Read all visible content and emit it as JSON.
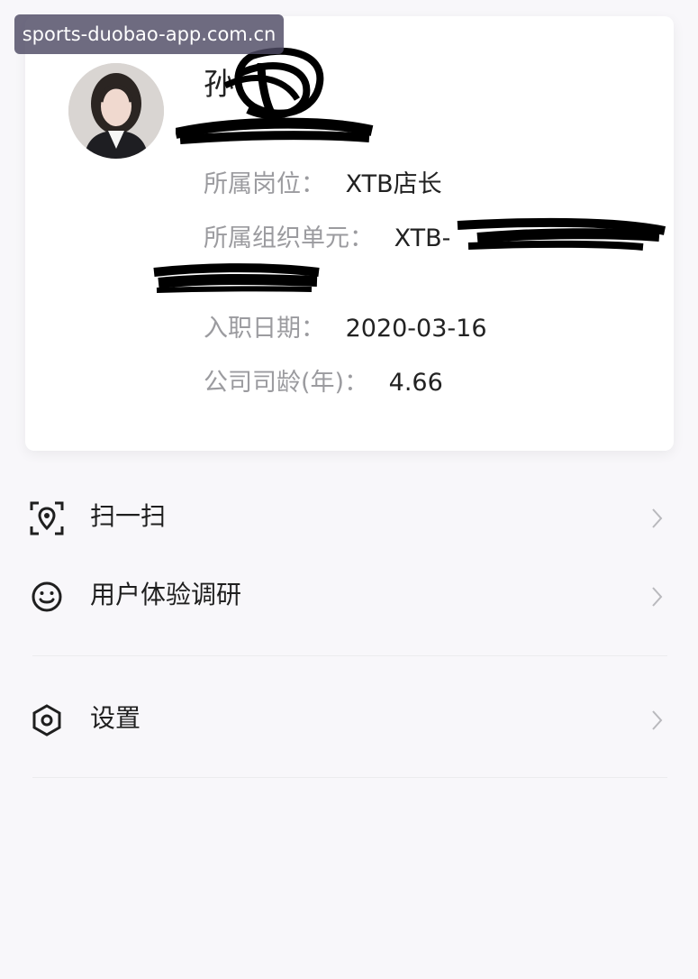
{
  "watermark": {
    "text": "sports-duobao-app.com.cn"
  },
  "profile": {
    "name_visible": "孙",
    "fields": [
      {
        "label": "所属岗位：",
        "value": "XTB店长"
      },
      {
        "label": "所属组织单元：",
        "value": "XTB-"
      },
      {
        "label": "入职日期：",
        "value": "2020-03-16"
      },
      {
        "label": "公司司龄(年)：",
        "value": "4.66"
      }
    ]
  },
  "menu": {
    "items": [
      {
        "label": "扫一扫",
        "icon": "scan-location-icon"
      },
      {
        "label": "用户体验调研",
        "icon": "smile-icon"
      },
      {
        "label": "设置",
        "icon": "hexagon-settings-icon"
      }
    ]
  },
  "colors": {
    "background": "#f8f7fa",
    "card": "#ffffff",
    "label": "#9b9b9f",
    "value": "#222222",
    "redaction": "#000000"
  }
}
